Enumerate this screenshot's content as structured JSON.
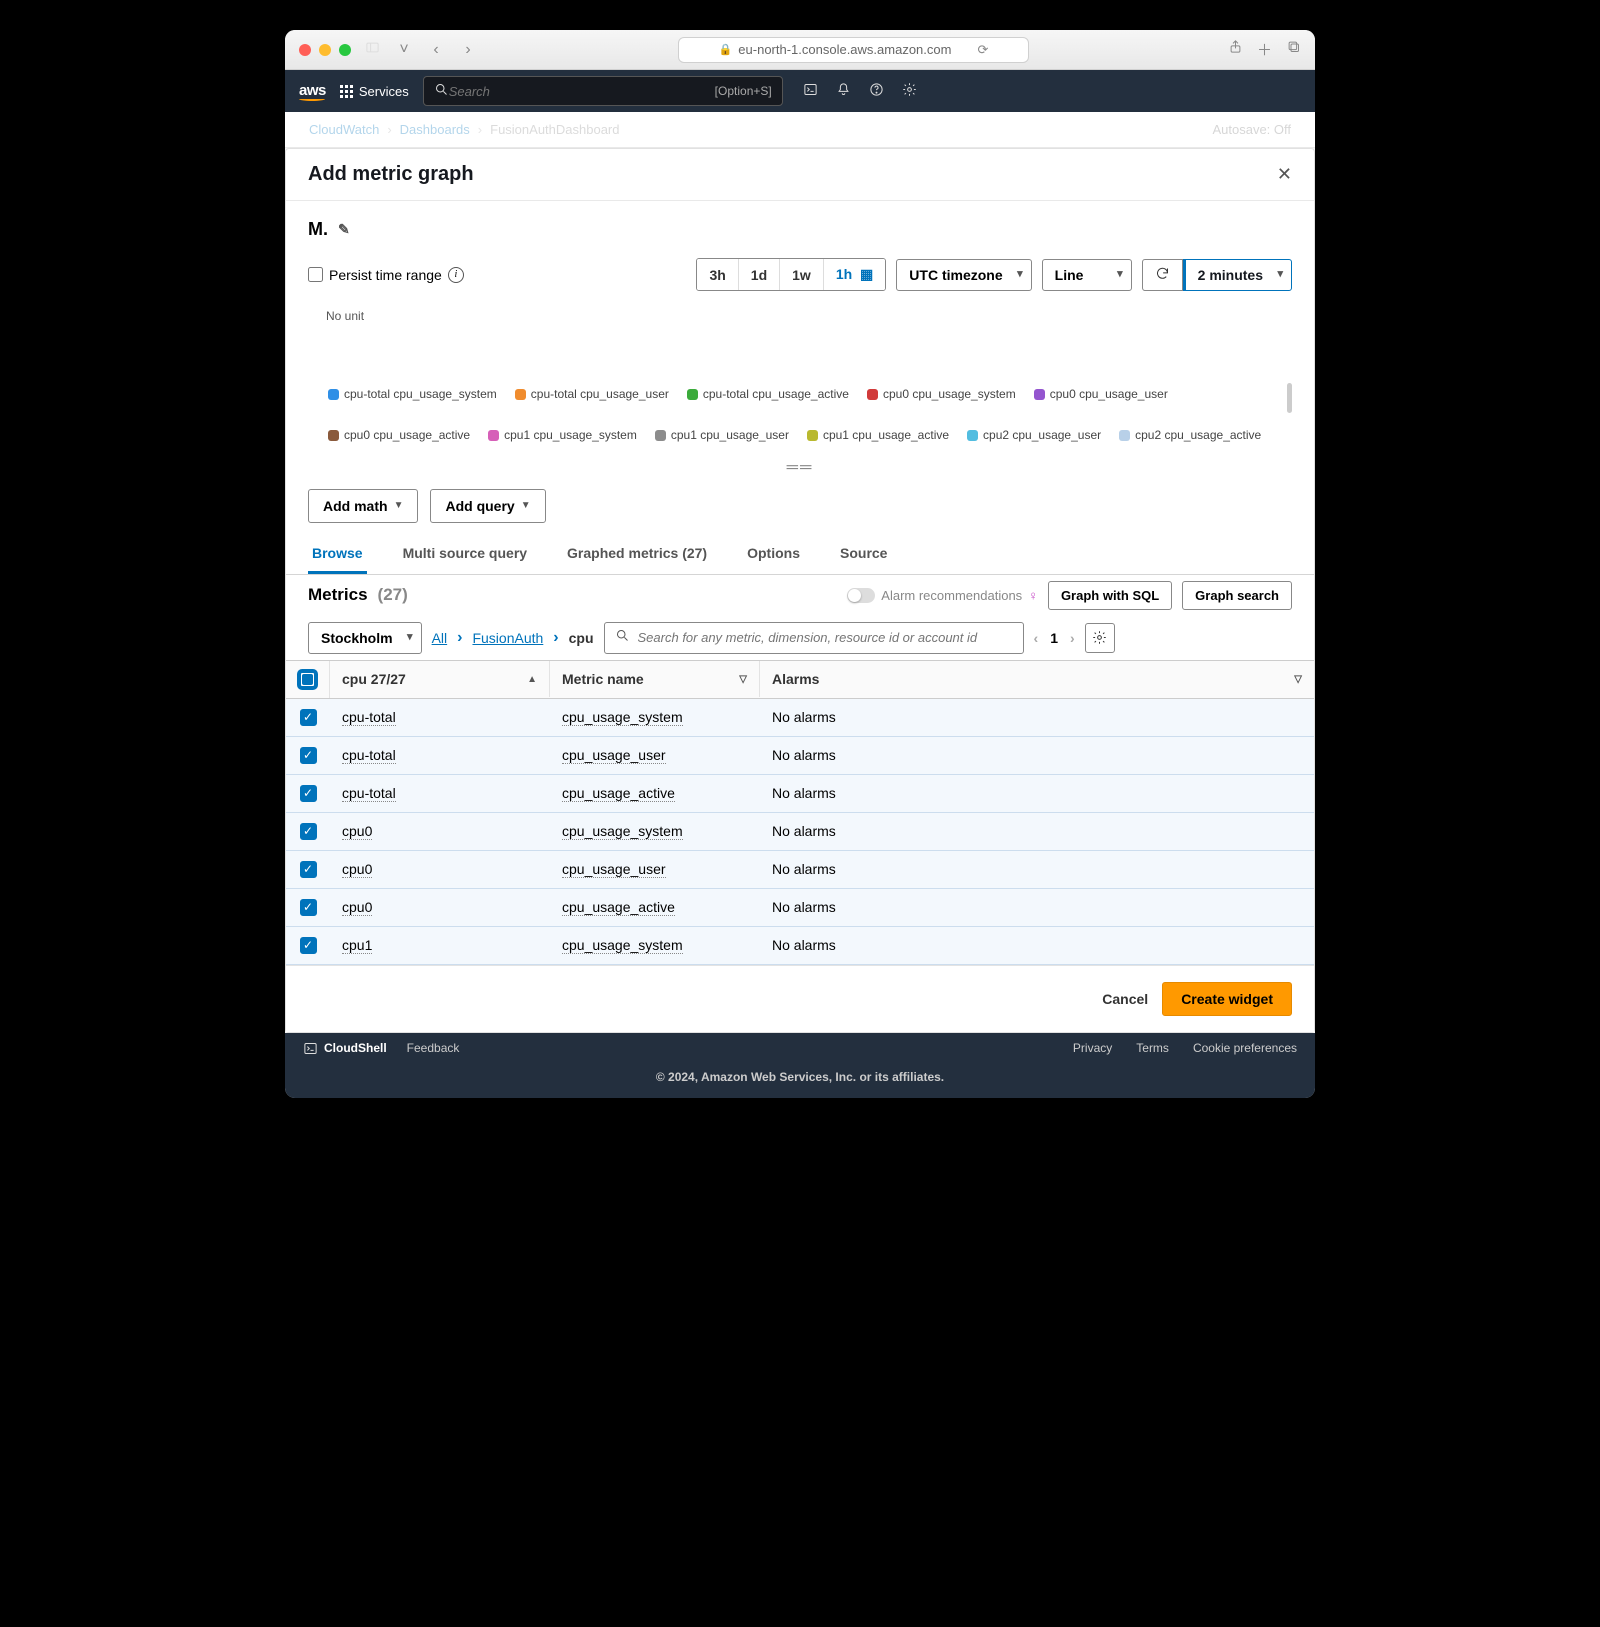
{
  "browser": {
    "url": "eu-north-1.console.aws.amazon.com"
  },
  "awsbar": {
    "logo": "aws",
    "services": "Services",
    "search_placeholder": "Search",
    "search_hint": "[Option+S]"
  },
  "breadcrumb": {
    "root": "CloudWatch",
    "mid": "Dashboards",
    "leaf": "FusionAuthDashboard",
    "autosave": "Autosave: Off"
  },
  "modal": {
    "title": "Add metric graph",
    "graph_name": "M.",
    "persist_label": "Persist time range",
    "ranges": {
      "r3h": "3h",
      "r1d": "1d",
      "r1w": "1w",
      "r1h": "1h"
    },
    "timezone": "UTC timezone",
    "chart_type": "Line",
    "refresh": "2 minutes",
    "no_unit": "No unit",
    "add_math": "Add math",
    "add_query": "Add query",
    "tabs": {
      "browse": "Browse",
      "multi": "Multi source query",
      "graphed": "Graphed metrics (27)",
      "options": "Options",
      "source": "Source"
    },
    "metrics_label": "Metrics",
    "metrics_count": "(27)",
    "alarm_rec": "Alarm recommendations",
    "graph_sql": "Graph with SQL",
    "graph_search": "Graph search",
    "region": "Stockholm",
    "crumbs": {
      "all": "All",
      "ns": "FusionAuth",
      "dim": "cpu"
    },
    "search_placeholder": "Search for any metric, dimension, resource id or account id",
    "page": "1",
    "columns": {
      "cpu": "cpu 27/27",
      "metric": "Metric name",
      "alarms": "Alarms"
    },
    "rows": [
      {
        "cpu": "cpu-total",
        "metric": "cpu_usage_system",
        "alarm": "No alarms"
      },
      {
        "cpu": "cpu-total",
        "metric": "cpu_usage_user",
        "alarm": "No alarms"
      },
      {
        "cpu": "cpu-total",
        "metric": "cpu_usage_active",
        "alarm": "No alarms"
      },
      {
        "cpu": "cpu0",
        "metric": "cpu_usage_system",
        "alarm": "No alarms"
      },
      {
        "cpu": "cpu0",
        "metric": "cpu_usage_user",
        "alarm": "No alarms"
      },
      {
        "cpu": "cpu0",
        "metric": "cpu_usage_active",
        "alarm": "No alarms"
      },
      {
        "cpu": "cpu1",
        "metric": "cpu_usage_system",
        "alarm": "No alarms"
      }
    ],
    "cancel": "Cancel",
    "create": "Create widget"
  },
  "legend": [
    {
      "c": "#2f8fe6",
      "t": "cpu-total cpu_usage_system"
    },
    {
      "c": "#f08c2e",
      "t": "cpu-total cpu_usage_user"
    },
    {
      "c": "#3bab3b",
      "t": "cpu-total cpu_usage_active"
    },
    {
      "c": "#d13a3a",
      "t": "cpu0 cpu_usage_system"
    },
    {
      "c": "#9455cf",
      "t": "cpu0 cpu_usage_user"
    },
    {
      "c": "#8a5a3c",
      "t": "cpu0 cpu_usage_active"
    },
    {
      "c": "#d65fb8",
      "t": "cpu1 cpu_usage_system"
    },
    {
      "c": "#8c8c8c",
      "t": "cpu1 cpu_usage_user"
    },
    {
      "c": "#b9b92f",
      "t": "cpu1 cpu_usage_active"
    },
    {
      "c": "#52bde0",
      "t": "cpu2 cpu_usage_user"
    },
    {
      "c": "#b8d0e8",
      "t": "cpu2 cpu_usage_active"
    }
  ],
  "footer": {
    "cloudshell": "CloudShell",
    "feedback": "Feedback",
    "privacy": "Privacy",
    "terms": "Terms",
    "cookie": "Cookie preferences",
    "copy": "© 2024, Amazon Web Services, Inc. or its affiliates."
  }
}
